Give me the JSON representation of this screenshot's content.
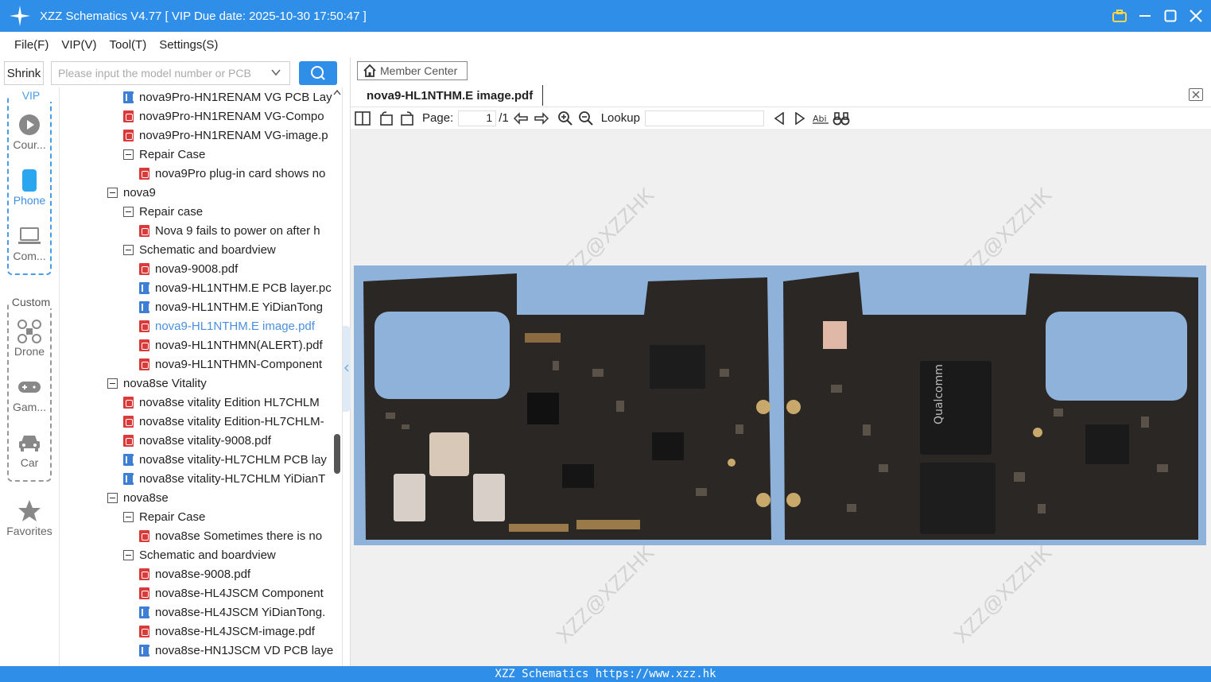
{
  "window": {
    "title": "XZZ Schematics V4.77 [ VIP Due date: 2025-10-30 17:50:47 ]"
  },
  "menu": [
    "File(F)",
    "VIP(V)",
    "Tool(T)",
    "Settings(S)"
  ],
  "search": {
    "shrink_label": "Shrink",
    "placeholder": "Please input the model number or PCB"
  },
  "rail": {
    "vip_label": "VIP",
    "custom_label": "Custom",
    "items": [
      {
        "label": "Cour...",
        "icon": "play-icon"
      },
      {
        "label": "Phone",
        "icon": "phone-icon"
      },
      {
        "label": "Com...",
        "icon": "laptop-icon"
      },
      {
        "label": "Drone",
        "icon": "drone-icon"
      },
      {
        "label": "Gam...",
        "icon": "gamepad-icon"
      },
      {
        "label": "Car",
        "icon": "car-icon"
      },
      {
        "label": "Favorites",
        "icon": "star-icon"
      }
    ]
  },
  "tree": [
    {
      "type": "pcb",
      "level": 1,
      "label": "nova9Pro-HN1RENAM VG PCB Lay"
    },
    {
      "type": "pdf",
      "level": 1,
      "label": "nova9Pro-HN1RENAM VG-Compo"
    },
    {
      "type": "pdf",
      "level": 1,
      "label": "nova9Pro-HN1RENAM VG-image.p"
    },
    {
      "type": "folder",
      "level": 1,
      "label": "Repair Case"
    },
    {
      "type": "pdf",
      "level": 2,
      "label": "nova9Pro plug-in card shows no"
    },
    {
      "type": "folder",
      "level": 0,
      "label": "nova9"
    },
    {
      "type": "folder",
      "level": 1,
      "label": "Repair case"
    },
    {
      "type": "pdf",
      "level": 2,
      "label": "Nova 9 fails to power on after h"
    },
    {
      "type": "folder",
      "level": 1,
      "label": "Schematic and boardview"
    },
    {
      "type": "pdf",
      "level": 2,
      "label": "nova9-9008.pdf"
    },
    {
      "type": "pcb",
      "level": 2,
      "label": "nova9-HL1NTHM.E PCB layer.pc"
    },
    {
      "type": "pcb",
      "level": 2,
      "label": "nova9-HL1NTHM.E YiDianTong"
    },
    {
      "type": "pdf",
      "level": 2,
      "label": "nova9-HL1NTHM.E image.pdf",
      "selected": true
    },
    {
      "type": "pdf",
      "level": 2,
      "label": "nova9-HL1NTHMN(ALERT).pdf"
    },
    {
      "type": "pdf",
      "level": 2,
      "label": "nova9-HL1NTHMN-Component"
    },
    {
      "type": "folder",
      "level": 0,
      "label": "nova8se Vitality"
    },
    {
      "type": "pdf",
      "level": 1,
      "label": "nova8se vitality Edition HL7CHLM"
    },
    {
      "type": "pdf",
      "level": 1,
      "label": "nova8se vitality Edition-HL7CHLM-"
    },
    {
      "type": "pdf",
      "level": 1,
      "label": "nova8se vitality-9008.pdf"
    },
    {
      "type": "pcb",
      "level": 1,
      "label": "nova8se vitality-HL7CHLM PCB lay"
    },
    {
      "type": "pcb",
      "level": 1,
      "label": "nova8se vitality-HL7CHLM YiDianT"
    },
    {
      "type": "folder",
      "level": 0,
      "label": "nova8se"
    },
    {
      "type": "folder",
      "level": 1,
      "label": "Repair Case"
    },
    {
      "type": "pdf",
      "level": 2,
      "label": "nova8se Sometimes there is no"
    },
    {
      "type": "folder",
      "level": 1,
      "label": "Schematic and boardview"
    },
    {
      "type": "pdf",
      "level": 2,
      "label": "nova8se-9008.pdf"
    },
    {
      "type": "pdf",
      "level": 2,
      "label": "nova8se-HL4JSCM Component"
    },
    {
      "type": "pcb",
      "level": 2,
      "label": "nova8se-HL4JSCM YiDianTong."
    },
    {
      "type": "pdf",
      "level": 2,
      "label": "nova8se-HL4JSCM-image.pdf"
    },
    {
      "type": "pcb",
      "level": 2,
      "label": "nova8se-HN1JSCM VD PCB laye"
    }
  ],
  "viewer": {
    "member_center": "Member Center",
    "doc_tab": "nova9-HL1NTHM.E image.pdf",
    "page_label": "Page:",
    "page_value": "1",
    "page_total": "/1",
    "lookup_label": "Lookup",
    "watermark": "XZZ@XZZHK"
  },
  "status": {
    "text": "XZZ Schematics https://www.xzz.hk"
  },
  "colors": {
    "accent": "#2f8fe8",
    "pdf": "#d93a3a",
    "pcb": "#3e7fd6",
    "selected": "#4a8fe0"
  }
}
